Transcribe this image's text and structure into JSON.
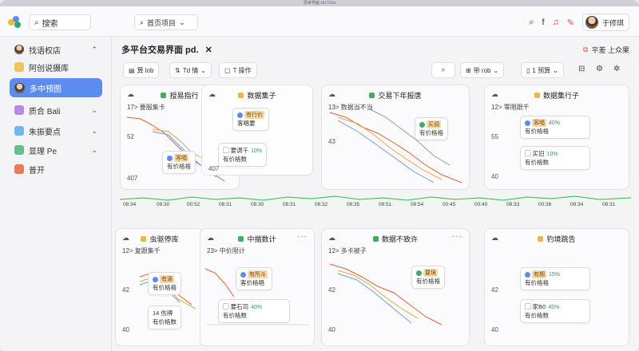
{
  "window": {
    "title": "思考界面 ctrl 10ce"
  },
  "topbar": {
    "search_value": "搜索",
    "workspace_label": "首页项目",
    "user_name": "于修琪"
  },
  "sidebar": {
    "items": [
      {
        "label": "找语权店",
        "has_chevron": true
      },
      {
        "label": "阿创说摄库",
        "has_chevron": false
      },
      {
        "label": "多中预图",
        "has_chevron": false,
        "active": true
      },
      {
        "label": "质合 Bali",
        "has_chevron": true
      },
      {
        "label": "朱振要点",
        "has_chevron": true
      },
      {
        "label": "显理 Pe",
        "has_chevron": true
      },
      {
        "label": "普开",
        "has_chevron": false
      }
    ]
  },
  "main": {
    "title": "多平台交易界面 pd.",
    "top_right_label": "平差 上众果",
    "toolbar": {
      "btn1": "算 lob",
      "btn2": "Td 情",
      "btn3": "T 操作",
      "btn4": "带 rob",
      "btn5": "1 预算"
    }
  },
  "cards": [
    {
      "title": "授易指行",
      "dot_color": "#3fae5f",
      "subtitle": "17> 要服集卡",
      "num1": "52",
      "num2": "407",
      "pill1_title": "客唱",
      "pill1_sub": "有价格格",
      "pill2_title": "",
      "pill2_pct": "",
      "pill2_sub": ""
    },
    {
      "title": "数据集子",
      "dot_color": "#e8b84a",
      "subtitle": "",
      "num1": "",
      "num2": "407",
      "pill1_title": "有行价",
      "pill1_sub": "客唱要",
      "pill2_title": "要调千",
      "pill2_pct": "10%",
      "pill2_sub": "有价格数"
    },
    {
      "title": "交易下年报唐",
      "dot_color": "#3fae5f",
      "subtitle": "13> 数据当不当",
      "num1": "43",
      "num2": "",
      "pill1_title": "买调",
      "pill1_sub": "有价格格",
      "pill2_title": "",
      "pill2_pct": "",
      "pill2_sub": ""
    },
    {
      "title": "数据集行子",
      "dot_color": "#e8b84a",
      "subtitle": "12> 零限跟千",
      "num1": "55",
      "num2": "40",
      "pill1_title": "客唱",
      "pill1_pct": "40%",
      "pill1_sub": "有价格格",
      "pill2_title": "买旧",
      "pill2_pct": "10%",
      "pill2_sub": "有价格数"
    },
    {
      "title": "虫驱停库",
      "dot_color": "#e8b84a",
      "subtitle": "12> 复跟集千",
      "num1": "42",
      "num2": "40",
      "pill1_title": "有滴",
      "pill1_sub": "有价格格",
      "pill2_title": "14 伤牌",
      "pill2_pct": "",
      "pill2_sub": "有价格数"
    },
    {
      "title": "中揣数计",
      "dot_color": "#3fae5f",
      "subtitle": "23> 中价限计",
      "num1": "",
      "num2": "",
      "pill1_title": "有所斗",
      "pill1_sub": "客价格唱",
      "pill2_title": "要石司",
      "pill2_pct": "40%",
      "pill2_sub": "有价格数"
    },
    {
      "title": "数据不致许",
      "dot_color": "#3fae5f",
      "subtitle": "12> 多卡被子",
      "num1": "42",
      "num2": "40",
      "pill1_title": "要境",
      "pill1_sub": "有价格格",
      "pill2_title": "",
      "pill2_pct": "",
      "pill2_sub": ""
    },
    {
      "title": "钓境跳告",
      "dot_color": "#e8b84a",
      "subtitle": "",
      "num1": "42",
      "num2": "40",
      "pill1_title": "有期",
      "pill1_pct": "15%",
      "pill1_sub": "有价格格",
      "pill2_title": "家B0",
      "pill2_pct": "45%",
      "pill2_sub": "有价格数"
    }
  ],
  "timeline": {
    "labels": [
      "08:34",
      "08:30",
      "00:52",
      "08:31",
      "09:30",
      "08:31",
      "08:32",
      "08:35",
      "08:51",
      "08:54",
      "00:45",
      "00:40",
      "08:33",
      "00:38",
      "08:34",
      "08:31"
    ]
  }
}
